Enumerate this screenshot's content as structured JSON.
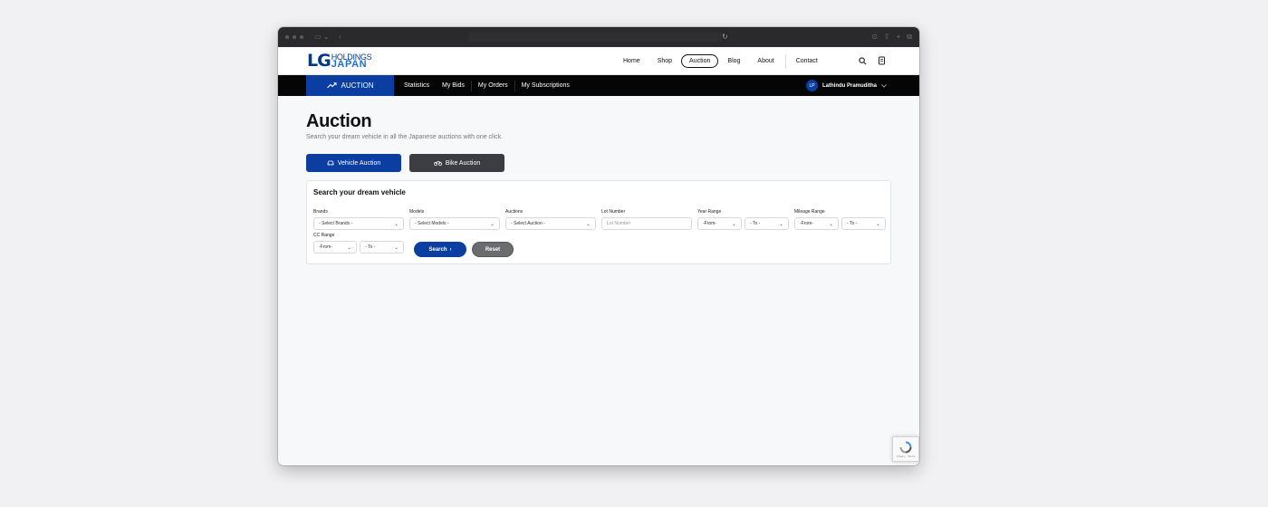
{
  "browser": {
    "reload_icon": "reload-icon"
  },
  "header": {
    "logo": {
      "mark": "LG",
      "line1": "HOLDINGS",
      "line2": "JAPAN"
    },
    "nav": [
      {
        "label": "Home"
      },
      {
        "label": "Shop"
      },
      {
        "label": "Auction",
        "active": true
      },
      {
        "label": "Blog"
      },
      {
        "label": "About"
      },
      {
        "label": "Contact"
      }
    ],
    "icons": [
      "search-icon",
      "cart-icon"
    ]
  },
  "subnav": {
    "auction_label": "AUCTION",
    "links": [
      "Statistics",
      "My Bids",
      "My Orders",
      "My Subscriptions"
    ],
    "user": {
      "initials": "LP",
      "name": "Lathindu Pramuditha"
    }
  },
  "page": {
    "title": "Auction",
    "subtitle": "Search your dream vehicle in all the Japanese auctions with one click.",
    "tabs": {
      "vehicle": "Vehicle Auction",
      "bike": "Bike Auction"
    }
  },
  "search": {
    "title": "Search your dream vehicle",
    "brands": {
      "label": "Brands",
      "value": "- Select Brands -"
    },
    "models": {
      "label": "Models",
      "value": "- Select Models -"
    },
    "auctions": {
      "label": "Auctions",
      "value": "- Select Auction -"
    },
    "lot": {
      "label": "Lot Number",
      "placeholder": "Lot Number"
    },
    "year": {
      "label": "Year Range",
      "from": "-From-",
      "to": "- To -"
    },
    "mileage": {
      "label": "Mileage Range",
      "from": "-From-",
      "to": "- To -"
    },
    "cc": {
      "label": "CC Range",
      "from": "-From-",
      "to": "- To -"
    },
    "search_label": "Search",
    "reset_label": "Reset"
  },
  "recaptcha": {
    "text": "Privacy - Terms"
  },
  "colors": {
    "brand": "#0a3ea1",
    "nav_bg": "#050505",
    "bike_tab": "#3b3d42"
  }
}
